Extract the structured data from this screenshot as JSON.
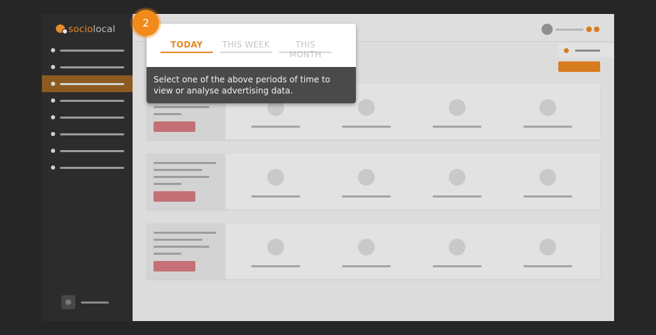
{
  "brand": {
    "logo_part1": "socio",
    "logo_part2": "local",
    "accent_color": "#e48a24"
  },
  "sidebar": {
    "items": [
      {
        "name": "nav-item-1",
        "active": false
      },
      {
        "name": "nav-item-2",
        "active": false
      },
      {
        "name": "nav-item-3",
        "active": true
      },
      {
        "name": "nav-item-4",
        "active": false
      },
      {
        "name": "nav-item-5",
        "active": false
      },
      {
        "name": "nav-item-6",
        "active": false
      },
      {
        "name": "nav-item-7",
        "active": false
      },
      {
        "name": "nav-item-8",
        "active": false
      }
    ]
  },
  "tour": {
    "step_number": "2",
    "tabs": [
      {
        "label": "TODAY",
        "selected": true
      },
      {
        "label": "THIS WEEK",
        "selected": false
      },
      {
        "label": "THIS MONTH",
        "selected": false
      }
    ],
    "description": "Select one of the above periods of time to view or analyse advertising data."
  },
  "cards": [
    {
      "metrics": 4
    },
    {
      "metrics": 4
    },
    {
      "metrics": 4
    }
  ]
}
